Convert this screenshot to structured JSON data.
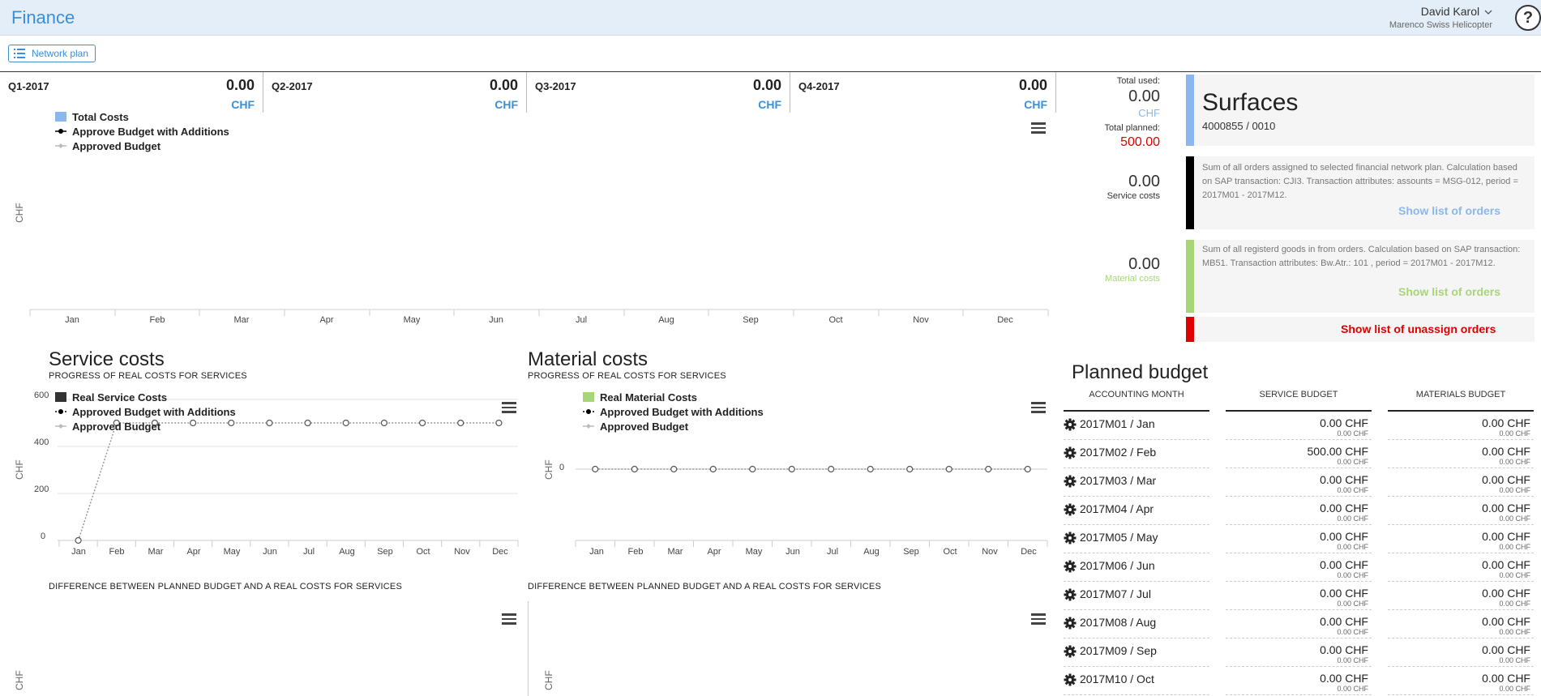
{
  "header": {
    "title": "Finance",
    "user_name": "David Karol",
    "company": "Marenco Swiss Helicopter",
    "help": "?"
  },
  "toolbar": {
    "network_plan": "Network plan"
  },
  "quarters": [
    {
      "label": "Q1-2017",
      "value": "0.00",
      "unit": "CHF"
    },
    {
      "label": "Q2-2017",
      "value": "0.00",
      "unit": "CHF"
    },
    {
      "label": "Q3-2017",
      "value": "0.00",
      "unit": "CHF"
    },
    {
      "label": "Q4-2017",
      "value": "0.00",
      "unit": "CHF"
    }
  ],
  "months": [
    "Jan",
    "Feb",
    "Mar",
    "Apr",
    "May",
    "Jun",
    "Jul",
    "Aug",
    "Sep",
    "Oct",
    "Nov",
    "Dec"
  ],
  "colors": {
    "accent": "#3a8fd8",
    "total_costs": "#8ab8ee",
    "real_material": "#a8d577",
    "real_service": "#333333",
    "red": "#e00000",
    "black_stripe": "#000000"
  },
  "main_chart": {
    "ylabel": "CHF",
    "legend": [
      "Total Costs",
      "Approve Budget with Additions",
      "Approved Budget"
    ]
  },
  "service_section": {
    "title": "Service costs",
    "subtitle": "PROGRESS OF REAL COSTS FOR SERVICES",
    "diff_title": "DIFFERENCE BETWEEN PLANNED BUDGET AND A REAL COSTS FOR SERVICES",
    "ylabel": "CHF",
    "legend": [
      "Real Service Costs",
      "Approved Budget with Additions",
      "Approved Budget"
    ],
    "y_ticks": [
      "600",
      "400",
      "200",
      "0"
    ]
  },
  "material_section": {
    "title": "Material costs",
    "subtitle": "PROGRESS OF REAL COSTS FOR SERVICES",
    "diff_title": "DIFFERENCE BETWEEN PLANNED BUDGET AND A REAL COSTS FOR SERVICES",
    "ylabel": "CHF",
    "legend": [
      "Real Material Costs",
      "Approved Budget with Additions",
      "Approved Budget"
    ],
    "y_ticks": [
      "0"
    ]
  },
  "chart_data": [
    {
      "type": "line",
      "ylabel": "CHF",
      "categories": [
        "Jan",
        "Feb",
        "Mar",
        "Apr",
        "May",
        "Jun",
        "Jul",
        "Aug",
        "Sep",
        "Oct",
        "Nov",
        "Dec"
      ],
      "series": [
        {
          "name": "Real Service Costs",
          "values": [
            0,
            0,
            0,
            0,
            0,
            0,
            0,
            0,
            0,
            0,
            0,
            0
          ]
        },
        {
          "name": "Approved Budget with Additions",
          "values": [
            0,
            500,
            500,
            500,
            500,
            500,
            500,
            500,
            500,
            500,
            500,
            500
          ]
        },
        {
          "name": "Approved Budget",
          "values": [
            0,
            500,
            500,
            500,
            500,
            500,
            500,
            500,
            500,
            500,
            500,
            500
          ]
        }
      ],
      "ylim": [
        0,
        600
      ],
      "y_ticks": [
        0,
        200,
        400,
        600
      ]
    },
    {
      "type": "line",
      "ylabel": "CHF",
      "categories": [
        "Jan",
        "Feb",
        "Mar",
        "Apr",
        "May",
        "Jun",
        "Jul",
        "Aug",
        "Sep",
        "Oct",
        "Nov",
        "Dec"
      ],
      "series": [
        {
          "name": "Real Material Costs",
          "values": [
            0,
            0,
            0,
            0,
            0,
            0,
            0,
            0,
            0,
            0,
            0,
            0
          ]
        },
        {
          "name": "Approved Budget with Additions",
          "values": [
            0,
            0,
            0,
            0,
            0,
            0,
            0,
            0,
            0,
            0,
            0,
            0
          ]
        },
        {
          "name": "Approved Budget",
          "values": [
            0,
            0,
            0,
            0,
            0,
            0,
            0,
            0,
            0,
            0,
            0,
            0
          ]
        }
      ],
      "y_ticks": [
        0
      ]
    }
  ],
  "summary": {
    "total_used_label": "Total used:",
    "total_used": "0.00",
    "total_used_unit": "CHF",
    "total_planned_label": "Total planned:",
    "total_planned": "500.00",
    "surface_title": "Surfaces",
    "surface_id": "4000855 / 0010",
    "service_value": "0.00",
    "service_label": "Service costs",
    "service_desc": "Sum of all orders assigned to selected financial network plan. Calculation based on SAP transaction: CJI3. Transaction attributes: assounts = MSG-012, period = 2017M01 - 2017M12.",
    "service_link": "Show list of orders",
    "material_value": "0.00",
    "material_label": "Material costs",
    "material_desc": "Sum of all registerd goods in from orders. Calculation based on SAP transaction: MB51. Transaction attributes: Bw.Atr.: 101 , period = 2017M01 - 2017M12.",
    "material_link": "Show list of orders",
    "unassign_link": "Show list of unassign orders"
  },
  "planned_budget": {
    "title": "Planned budget",
    "headers": [
      "ACCOUNTING MONTH",
      "SERVICE BUDGET",
      "MATERIALS BUDGET"
    ],
    "rows": [
      {
        "month": "2017M01 / Jan",
        "service": "0.00 CHF",
        "service_small": "0.00 CHF",
        "materials": "0.00 CHF",
        "materials_small": "0.00 CHF"
      },
      {
        "month": "2017M02 / Feb",
        "service": "500.00 CHF",
        "service_small": "0.00 CHF",
        "materials": "0.00 CHF",
        "materials_small": "0.00 CHF"
      },
      {
        "month": "2017M03 / Mar",
        "service": "0.00 CHF",
        "service_small": "0.00 CHF",
        "materials": "0.00 CHF",
        "materials_small": "0.00 CHF"
      },
      {
        "month": "2017M04 / Apr",
        "service": "0.00 CHF",
        "service_small": "0.00 CHF",
        "materials": "0.00 CHF",
        "materials_small": "0.00 CHF"
      },
      {
        "month": "2017M05 / May",
        "service": "0.00 CHF",
        "service_small": "0.00 CHF",
        "materials": "0.00 CHF",
        "materials_small": "0.00 CHF"
      },
      {
        "month": "2017M06 / Jun",
        "service": "0.00 CHF",
        "service_small": "0.00 CHF",
        "materials": "0.00 CHF",
        "materials_small": "0.00 CHF"
      },
      {
        "month": "2017M07 / Jul",
        "service": "0.00 CHF",
        "service_small": "0.00 CHF",
        "materials": "0.00 CHF",
        "materials_small": "0.00 CHF"
      },
      {
        "month": "2017M08 / Aug",
        "service": "0.00 CHF",
        "service_small": "0.00 CHF",
        "materials": "0.00 CHF",
        "materials_small": "0.00 CHF"
      },
      {
        "month": "2017M09 / Sep",
        "service": "0.00 CHF",
        "service_small": "0.00 CHF",
        "materials": "0.00 CHF",
        "materials_small": "0.00 CHF"
      },
      {
        "month": "2017M10 / Oct",
        "service": "0.00 CHF",
        "service_small": "0.00 CHF",
        "materials": "0.00 CHF",
        "materials_small": "0.00 CHF"
      }
    ]
  }
}
